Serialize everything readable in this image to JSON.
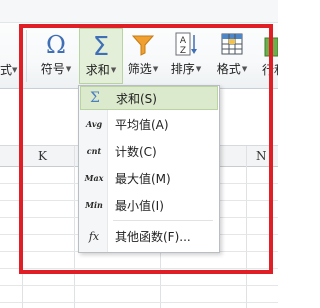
{
  "ribbon": {
    "cut_left_label": "式",
    "cut_right_label": "行和",
    "buttons": [
      {
        "id": "symbol",
        "label": "符号",
        "icon": "omega-icon"
      },
      {
        "id": "sum",
        "label": "求和",
        "icon": "sigma-icon"
      },
      {
        "id": "filter",
        "label": "筛选",
        "icon": "funnel-icon"
      },
      {
        "id": "sort",
        "label": "排序",
        "icon": "sort-az-icon"
      },
      {
        "id": "format",
        "label": "格式",
        "icon": "table-format-icon"
      }
    ],
    "dropdown_arrow": "▼"
  },
  "sheet": {
    "columns": [
      "K",
      "N"
    ]
  },
  "dropdown": {
    "items": [
      {
        "icon_text": "Σ",
        "label": "求和(S)"
      },
      {
        "icon_text": "Avg",
        "label": "平均值(A)"
      },
      {
        "icon_text": "cnt",
        "label": "计数(C)"
      },
      {
        "icon_text": "Max",
        "label": "最大值(M)"
      },
      {
        "icon_text": "Min",
        "label": "最小值(I)"
      },
      {
        "icon_text": "fx",
        "label": "其他函数(F)..."
      }
    ]
  },
  "colors": {
    "highlight_frame": "#e01e25",
    "active_button_bg": "#e3efd9",
    "menu_highlight_bg": "#dbe9cc",
    "sigma_blue": "#4a7fc1"
  }
}
